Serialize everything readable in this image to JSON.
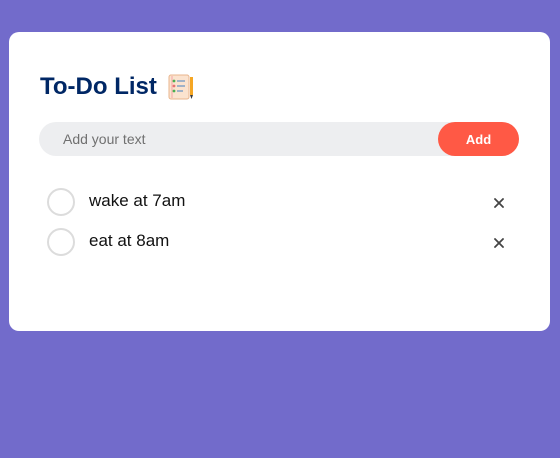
{
  "app": {
    "title": "To-Do List",
    "title_icon": "notepad-checklist-icon"
  },
  "input": {
    "placeholder": "Add your text",
    "value": ""
  },
  "add_button": {
    "label": "Add"
  },
  "tasks": [
    {
      "text": "wake at 7am",
      "checked": false,
      "delete_icon": "close-icon"
    },
    {
      "text": "eat at 8am",
      "checked": false,
      "delete_icon": "close-icon"
    }
  ],
  "colors": {
    "background": "#726bcb",
    "card": "#ffffff",
    "title": "#002765",
    "accent": "#ff5945",
    "input_bg": "#edeef0"
  }
}
